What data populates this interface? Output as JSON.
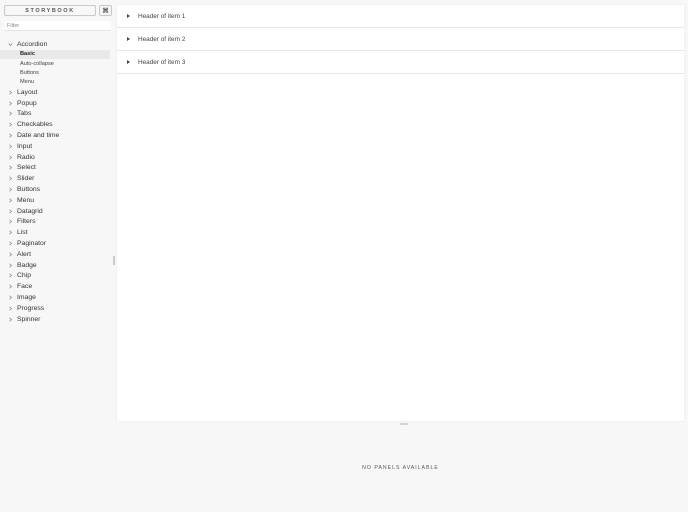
{
  "brand": {
    "title": "STORYBOOK",
    "shortcut_icon": "⌘"
  },
  "filter": {
    "placeholder": "Filter",
    "value": ""
  },
  "tree": {
    "expanded": {
      "label": "Accordion",
      "children": [
        "Basic",
        "Auto-collapse",
        "Buttons",
        "Menu"
      ],
      "selected": "Basic"
    },
    "collapsed": [
      "Layout",
      "Popup",
      "Tabs",
      "Checkables",
      "Date and time",
      "Input",
      "Radio",
      "Select",
      "Slider",
      "Buttons",
      "Menu",
      "Datagrid",
      "Filters",
      "List",
      "Paginator",
      "Alert",
      "Badge",
      "Chip",
      "Face",
      "Image",
      "Progress",
      "Spinner"
    ]
  },
  "preview": {
    "items": [
      "Header of item 1",
      "Header of item 2",
      "Header of item 3"
    ]
  },
  "addons": {
    "empty_text": "NO PANELS AVAILABLE"
  }
}
